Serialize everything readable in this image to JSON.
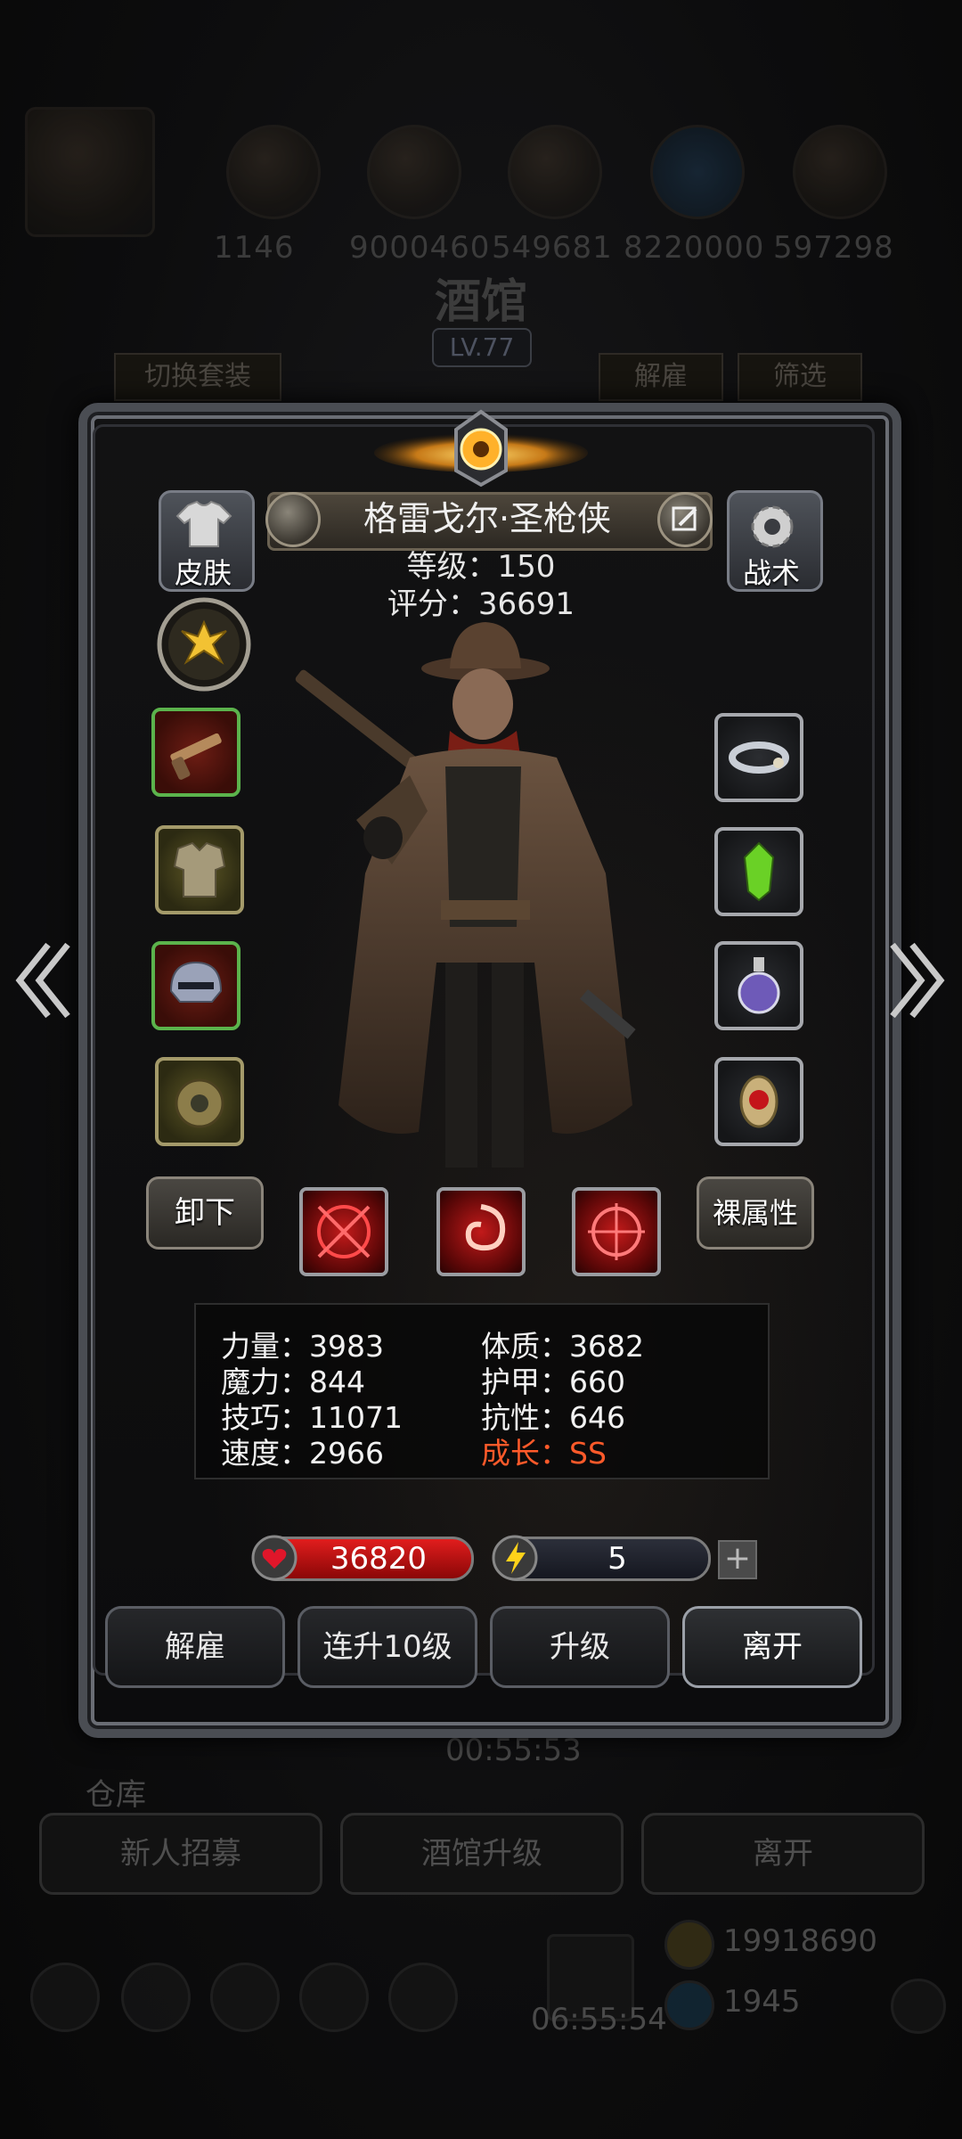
{
  "background": {
    "numbers": [
      "1146",
      "9000460",
      "549681",
      "8220000",
      "597298"
    ],
    "title": "酒馆",
    "level": "LV.77",
    "tab_switch_outfit": "切换套装",
    "tab_dismiss": "解雇",
    "tab_filter": "筛选",
    "timer_main": "00:55:53",
    "storage_label": "仓库",
    "buttons": [
      "新人招募",
      "酒馆升级",
      "离开"
    ],
    "timer_bottom": "06:55:54",
    "gold": "19918690",
    "gems": "1945"
  },
  "hero": {
    "name": "格雷戈尔·圣枪侠",
    "level_text": "等级：150",
    "score_text": "评分：36691",
    "skin_label": "皮肤",
    "tactics_label": "战术"
  },
  "equipment_left": [
    {
      "name": "rifle-icon",
      "rarity": "red"
    },
    {
      "name": "armor-icon",
      "rarity": "gold"
    },
    {
      "name": "helmet-icon",
      "rarity": "red"
    },
    {
      "name": "emblem-icon",
      "rarity": "gold"
    }
  ],
  "equipment_right": [
    {
      "name": "cloud-bracelet-icon"
    },
    {
      "name": "green-crystal-icon"
    },
    {
      "name": "potion-icon"
    },
    {
      "name": "ruby-amulet-icon"
    }
  ],
  "actions": {
    "unequip": "卸下",
    "base_stats": "裸属性"
  },
  "stats": {
    "strength": "力量：3983",
    "magic": "魔力：844",
    "skill": "技巧：11071",
    "speed": "速度：2966",
    "constitution": "体质：3682",
    "armor": "护甲：660",
    "resistance": "抗性：646",
    "growth": "成长：SS"
  },
  "vitals": {
    "hp": "36820",
    "energy": "5",
    "plus": "+"
  },
  "footer": {
    "dismiss": "解雇",
    "level_up_10": "连升10级",
    "level_up": "升级",
    "leave": "离开"
  },
  "colors": {
    "growth": "#ff5a2a",
    "hp": "#e11d1d",
    "skill_red": "#c21a1a"
  }
}
